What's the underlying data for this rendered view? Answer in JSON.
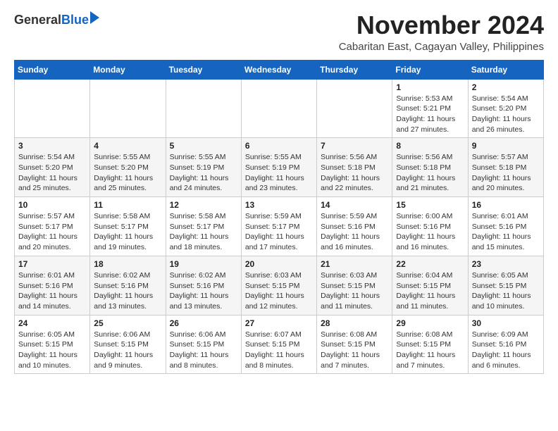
{
  "header": {
    "logo_general": "General",
    "logo_blue": "Blue",
    "month_title": "November 2024",
    "location": "Cabaritan East, Cagayan Valley, Philippines"
  },
  "calendar": {
    "days_of_week": [
      "Sunday",
      "Monday",
      "Tuesday",
      "Wednesday",
      "Thursday",
      "Friday",
      "Saturday"
    ],
    "weeks": [
      [
        {
          "day": "",
          "info": ""
        },
        {
          "day": "",
          "info": ""
        },
        {
          "day": "",
          "info": ""
        },
        {
          "day": "",
          "info": ""
        },
        {
          "day": "",
          "info": ""
        },
        {
          "day": "1",
          "info": "Sunrise: 5:53 AM\nSunset: 5:21 PM\nDaylight: 11 hours and 27 minutes."
        },
        {
          "day": "2",
          "info": "Sunrise: 5:54 AM\nSunset: 5:20 PM\nDaylight: 11 hours and 26 minutes."
        }
      ],
      [
        {
          "day": "3",
          "info": "Sunrise: 5:54 AM\nSunset: 5:20 PM\nDaylight: 11 hours and 25 minutes."
        },
        {
          "day": "4",
          "info": "Sunrise: 5:55 AM\nSunset: 5:20 PM\nDaylight: 11 hours and 25 minutes."
        },
        {
          "day": "5",
          "info": "Sunrise: 5:55 AM\nSunset: 5:19 PM\nDaylight: 11 hours and 24 minutes."
        },
        {
          "day": "6",
          "info": "Sunrise: 5:55 AM\nSunset: 5:19 PM\nDaylight: 11 hours and 23 minutes."
        },
        {
          "day": "7",
          "info": "Sunrise: 5:56 AM\nSunset: 5:18 PM\nDaylight: 11 hours and 22 minutes."
        },
        {
          "day": "8",
          "info": "Sunrise: 5:56 AM\nSunset: 5:18 PM\nDaylight: 11 hours and 21 minutes."
        },
        {
          "day": "9",
          "info": "Sunrise: 5:57 AM\nSunset: 5:18 PM\nDaylight: 11 hours and 20 minutes."
        }
      ],
      [
        {
          "day": "10",
          "info": "Sunrise: 5:57 AM\nSunset: 5:17 PM\nDaylight: 11 hours and 20 minutes."
        },
        {
          "day": "11",
          "info": "Sunrise: 5:58 AM\nSunset: 5:17 PM\nDaylight: 11 hours and 19 minutes."
        },
        {
          "day": "12",
          "info": "Sunrise: 5:58 AM\nSunset: 5:17 PM\nDaylight: 11 hours and 18 minutes."
        },
        {
          "day": "13",
          "info": "Sunrise: 5:59 AM\nSunset: 5:17 PM\nDaylight: 11 hours and 17 minutes."
        },
        {
          "day": "14",
          "info": "Sunrise: 5:59 AM\nSunset: 5:16 PM\nDaylight: 11 hours and 16 minutes."
        },
        {
          "day": "15",
          "info": "Sunrise: 6:00 AM\nSunset: 5:16 PM\nDaylight: 11 hours and 16 minutes."
        },
        {
          "day": "16",
          "info": "Sunrise: 6:01 AM\nSunset: 5:16 PM\nDaylight: 11 hours and 15 minutes."
        }
      ],
      [
        {
          "day": "17",
          "info": "Sunrise: 6:01 AM\nSunset: 5:16 PM\nDaylight: 11 hours and 14 minutes."
        },
        {
          "day": "18",
          "info": "Sunrise: 6:02 AM\nSunset: 5:16 PM\nDaylight: 11 hours and 13 minutes."
        },
        {
          "day": "19",
          "info": "Sunrise: 6:02 AM\nSunset: 5:16 PM\nDaylight: 11 hours and 13 minutes."
        },
        {
          "day": "20",
          "info": "Sunrise: 6:03 AM\nSunset: 5:15 PM\nDaylight: 11 hours and 12 minutes."
        },
        {
          "day": "21",
          "info": "Sunrise: 6:03 AM\nSunset: 5:15 PM\nDaylight: 11 hours and 11 minutes."
        },
        {
          "day": "22",
          "info": "Sunrise: 6:04 AM\nSunset: 5:15 PM\nDaylight: 11 hours and 11 minutes."
        },
        {
          "day": "23",
          "info": "Sunrise: 6:05 AM\nSunset: 5:15 PM\nDaylight: 11 hours and 10 minutes."
        }
      ],
      [
        {
          "day": "24",
          "info": "Sunrise: 6:05 AM\nSunset: 5:15 PM\nDaylight: 11 hours and 10 minutes."
        },
        {
          "day": "25",
          "info": "Sunrise: 6:06 AM\nSunset: 5:15 PM\nDaylight: 11 hours and 9 minutes."
        },
        {
          "day": "26",
          "info": "Sunrise: 6:06 AM\nSunset: 5:15 PM\nDaylight: 11 hours and 8 minutes."
        },
        {
          "day": "27",
          "info": "Sunrise: 6:07 AM\nSunset: 5:15 PM\nDaylight: 11 hours and 8 minutes."
        },
        {
          "day": "28",
          "info": "Sunrise: 6:08 AM\nSunset: 5:15 PM\nDaylight: 11 hours and 7 minutes."
        },
        {
          "day": "29",
          "info": "Sunrise: 6:08 AM\nSunset: 5:15 PM\nDaylight: 11 hours and 7 minutes."
        },
        {
          "day": "30",
          "info": "Sunrise: 6:09 AM\nSunset: 5:16 PM\nDaylight: 11 hours and 6 minutes."
        }
      ]
    ]
  }
}
